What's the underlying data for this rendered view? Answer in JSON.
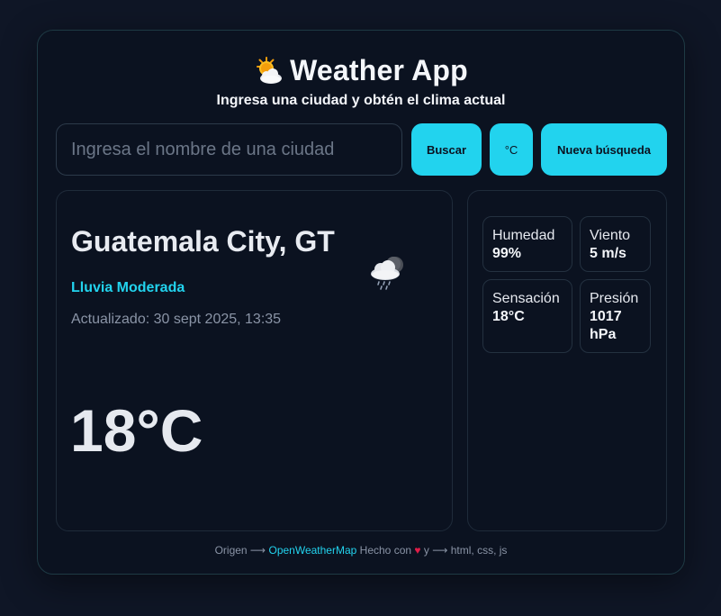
{
  "header": {
    "logo_icon": "sun-behind-cloud-icon",
    "title": "Weather App",
    "subtitle": "Ingresa una ciudad y obtén el clima actual"
  },
  "search": {
    "placeholder": "Ingresa el nombre de una ciudad",
    "value": "",
    "search_label": "Buscar",
    "unit_label": "°C",
    "new_search_label": "Nueva búsqueda"
  },
  "weather": {
    "city": "Guatemala City, GT",
    "description": "Lluvia Moderada",
    "updated": "Actualizado: 30 sept 2025, 13:35",
    "temperature": "18°C",
    "icon": "rain-cloud-icon"
  },
  "stats": {
    "humidity_label": "Humedad",
    "humidity_value": "99%",
    "wind_label": "Viento",
    "wind_value": "5 m/s",
    "feels_label": "Sensación",
    "feels_value": "18°C",
    "pressure_label": "Presión",
    "pressure_value": "1017 hPa"
  },
  "footer": {
    "source_prefix": "Origen ⟶",
    "source_link": "OpenWeatherMap",
    "made_with": "Hecho con",
    "heart": "♥",
    "made_suffix": "y ⟶ html, css, js"
  },
  "colors": {
    "accent": "#22d3ee",
    "background": "#0f1626",
    "card": "#0b1220",
    "heart": "#e11d48"
  }
}
